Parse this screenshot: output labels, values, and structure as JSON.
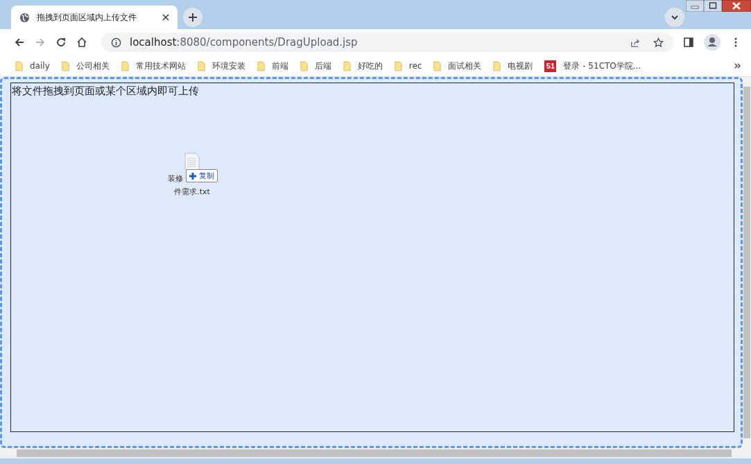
{
  "window": {
    "tab": {
      "title": "拖拽到页面区域内上传文件",
      "selected": true
    }
  },
  "toolbar": {
    "url": {
      "host": "localhost",
      "rest": ":8080/components/DragUpload.jsp"
    }
  },
  "bookmarks": [
    {
      "label": "daily",
      "kind": "folder"
    },
    {
      "label": "公司相关",
      "kind": "folder"
    },
    {
      "label": "常用技术网站",
      "kind": "folder"
    },
    {
      "label": "环境安装",
      "kind": "folder"
    },
    {
      "label": "前端",
      "kind": "folder"
    },
    {
      "label": "后端",
      "kind": "folder"
    },
    {
      "label": "好吃的",
      "kind": "folder"
    },
    {
      "label": "rec",
      "kind": "folder"
    },
    {
      "label": "面试相关",
      "kind": "folder"
    },
    {
      "label": "电视剧",
      "kind": "folder"
    },
    {
      "label": "登录 - 51CTO学院...",
      "kind": "site",
      "icon_text": "51"
    }
  ],
  "page": {
    "drop_zone": {
      "heading": "将文件拖拽到页面或某个区域内即可上传",
      "drag_over": true
    },
    "drag_ghost": {
      "name_lines": [
        "装修",
        "件需求.txt"
      ],
      "effect": "复制"
    }
  }
}
